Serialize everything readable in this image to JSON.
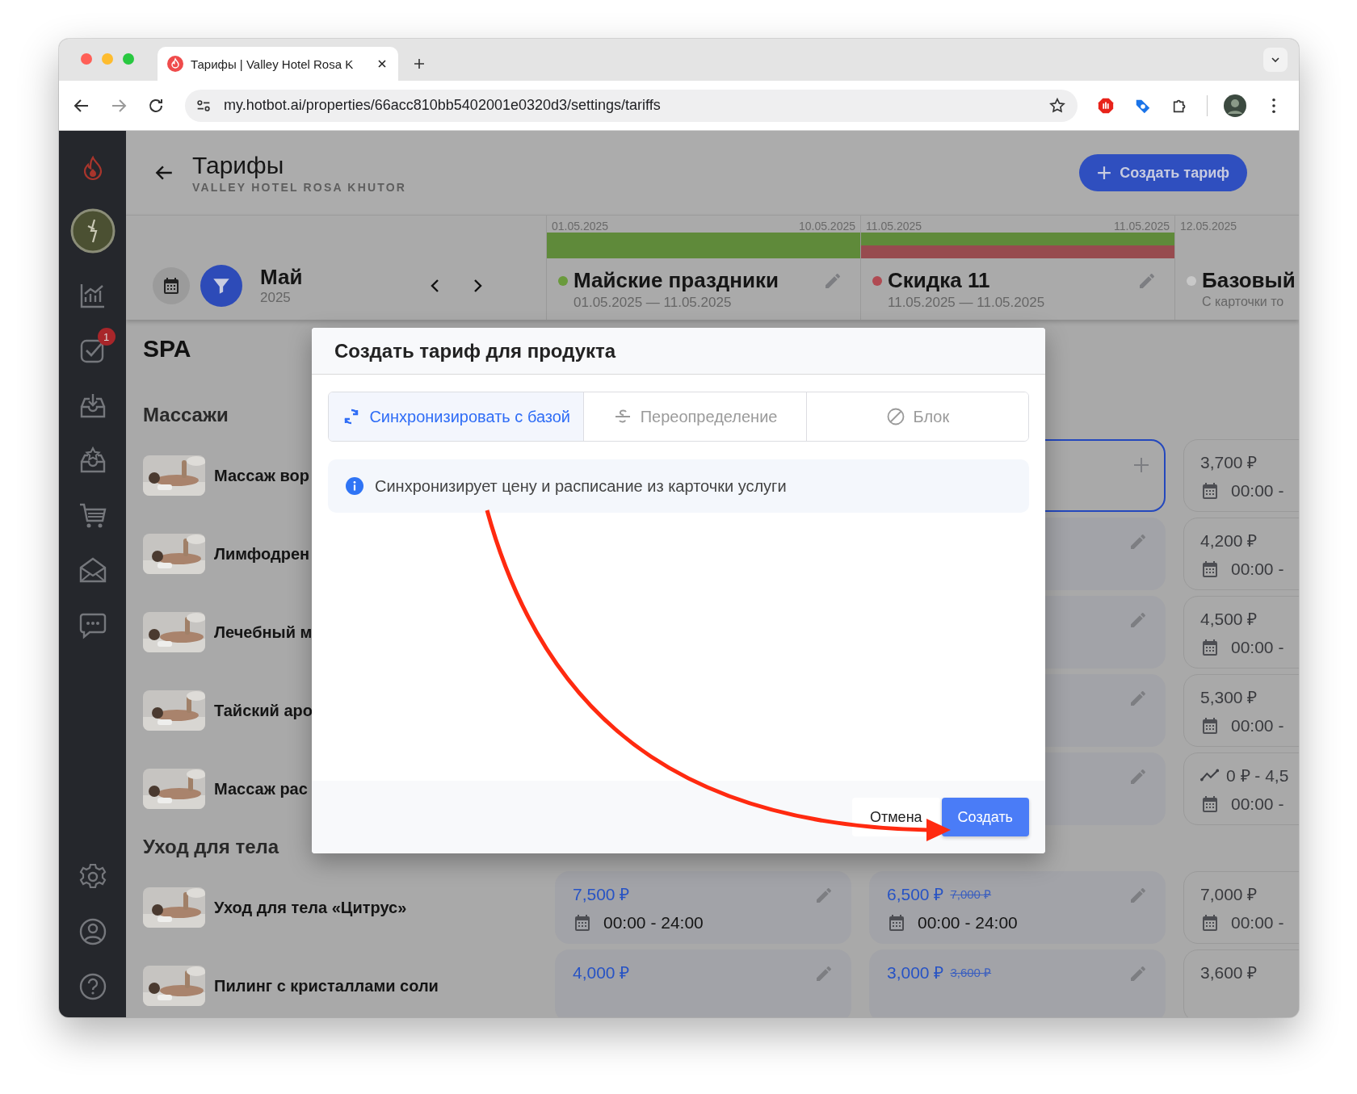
{
  "browser": {
    "tab_title": "Тарифы | Valley Hotel Rosa K",
    "url": "my.hotbot.ai/properties/66acc810bb5402001e0320d3/settings/tariffs"
  },
  "sidebar": {
    "task_badge": "1"
  },
  "header": {
    "title": "Тарифы",
    "subtitle": "VALLEY HOTEL ROSA KHUTOR",
    "create_button": "Создать тариф"
  },
  "period": {
    "month": "Май",
    "year": "2025"
  },
  "timeline": [
    {
      "kind": "custom",
      "date_start": "01.05.2025",
      "date_end": "10.05.2025",
      "name": "Майские праздники",
      "dates": "01.05.2025 — 11.05.2025",
      "color": "#6a9a3c",
      "bars": [
        {
          "color": "#5f8a3a"
        }
      ]
    },
    {
      "kind": "custom",
      "date_start": "11.05.2025",
      "date_end": "11.05.2025",
      "name": "Скидка 11",
      "dates": "11.05.2025 — 11.05.2025",
      "color": "#b04a52",
      "bars": [
        {
          "color": "#5f8a3a"
        },
        {
          "color": "#974b4f"
        }
      ]
    },
    {
      "kind": "base",
      "date_start": "12.05.2025",
      "name": "Базовый",
      "dates": "С карточки то",
      "color": "#c8c8c8"
    }
  ],
  "section": "SPA",
  "groups": [
    {
      "title": "Массажи",
      "products": [
        {
          "name": "Массаж вор",
          "cells": [
            null,
            {
              "kind": "empty",
              "selected": true
            },
            {
              "kind": "base",
              "price": "3,700 ₽",
              "time": "00:00 -",
              "dynamic": false,
              "selected": false
            }
          ]
        },
        {
          "name": "Лимфодрен",
          "cells": [
            null,
            {
              "kind": "custom",
              "selected": false
            },
            {
              "kind": "base",
              "price": "4,200 ₽",
              "time": "00:00 -",
              "dynamic": false,
              "selected": false
            }
          ]
        },
        {
          "name": "Лечебный м",
          "cells": [
            null,
            {
              "kind": "custom",
              "selected": false
            },
            {
              "kind": "base",
              "price": "4,500 ₽",
              "time": "00:00 -",
              "dynamic": false,
              "selected": false
            }
          ]
        },
        {
          "name": "Тайский аро",
          "cells": [
            null,
            {
              "kind": "custom",
              "selected": false
            },
            {
              "kind": "base",
              "price": "5,300 ₽",
              "time": "00:00 -",
              "dynamic": false,
              "selected": false
            }
          ]
        },
        {
          "name": "Массаж рас",
          "cells": [
            null,
            {
              "kind": "custom",
              "selected": false
            },
            {
              "kind": "base",
              "price": "0 ₽ - 4,5",
              "time": "00:00 -",
              "dynamic": true,
              "selected": false
            }
          ]
        }
      ]
    },
    {
      "title": "Уход для тела",
      "products": [
        {
          "name": "Уход для тела «Цитрус»",
          "cells": [
            {
              "kind": "custom",
              "price": "7,500 ₽",
              "time": "00:00 - 24:00",
              "selected": false
            },
            {
              "kind": "custom",
              "price": "6,500 ₽",
              "old_price": "7,000 ₽",
              "time": "00:00 - 24:00",
              "selected": false
            },
            {
              "kind": "base",
              "price": "7,000 ₽",
              "time": "00:00 -",
              "dynamic": false,
              "selected": false
            }
          ]
        },
        {
          "name": "Пилинг с кристаллами соли",
          "cells": [
            {
              "kind": "custom",
              "price": "4,000 ₽",
              "selected": false
            },
            {
              "kind": "custom",
              "price": "3,000 ₽",
              "old_price": "3,600 ₽",
              "selected": false
            },
            {
              "kind": "base",
              "price": "3,600 ₽",
              "dynamic": false,
              "selected": false
            }
          ]
        }
      ]
    }
  ],
  "modal": {
    "title": "Создать тариф для продукта",
    "tabs": [
      {
        "kind": "sync",
        "label": "Синхронизировать с базой",
        "selected": true
      },
      {
        "kind": "override",
        "label": "Переопределение",
        "selected": false
      },
      {
        "kind": "block",
        "label": "Блок",
        "selected": false
      }
    ],
    "info": "Синхронизирует цену и расписание из карточки услуги",
    "cancel_button": "Отмена",
    "submit_button": "Создать"
  }
}
